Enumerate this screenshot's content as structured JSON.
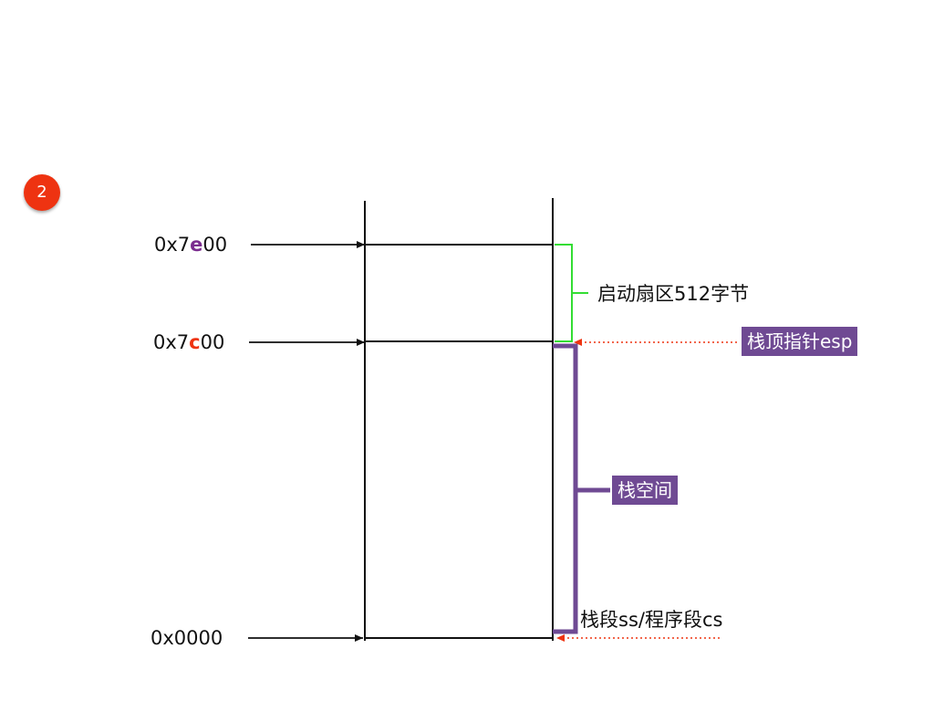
{
  "slide": {
    "number": "2"
  },
  "addresses": [
    {
      "prefix": "0x7",
      "highlight": "e",
      "suffix": "00",
      "highlight_color": "#7b2c8f"
    },
    {
      "prefix": "0x7",
      "highlight": "c",
      "suffix": "00",
      "highlight_color": "#ee3311"
    },
    {
      "prefix": "0x0000",
      "highlight": "",
      "suffix": ""
    }
  ],
  "labels": {
    "boot_sector": "启动扇区512字节",
    "stack_top": "栈顶指针esp",
    "stack_space": "栈空间",
    "segments": "栈段ss/程序段cs"
  },
  "colors": {
    "boot_bracket": "#33dd33",
    "stack_bracket": "#6f4a93",
    "pointer_arrow": "#ee3311",
    "badge": "#ee3311"
  }
}
